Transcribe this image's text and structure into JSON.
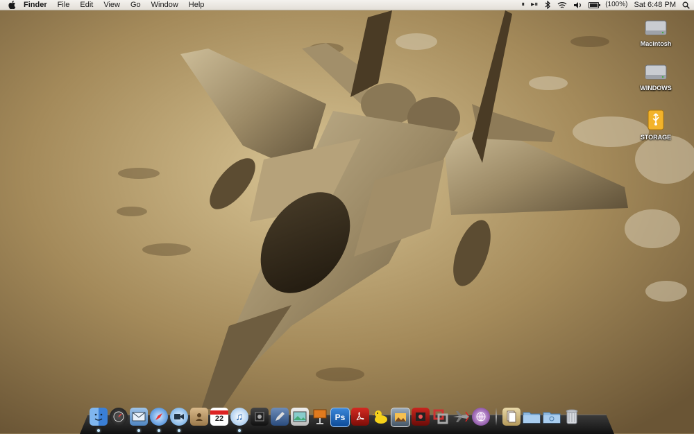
{
  "menubar": {
    "app_name": "Finder",
    "menus": [
      "File",
      "Edit",
      "View",
      "Go",
      "Window",
      "Help"
    ],
    "battery_text": "(100%)",
    "battery_level": 1.0,
    "clock": "Sat 6:48 PM",
    "status_icons": [
      "pause-icon",
      "play-pause-icon",
      "bluetooth-icon",
      "wifi-icon",
      "volume-icon",
      "battery-icon",
      "spotlight-icon"
    ]
  },
  "desktop_icons": [
    {
      "label": "Macintosh",
      "icon": "hard-drive-icon"
    },
    {
      "label": "WINDOWS",
      "icon": "hard-drive-icon"
    },
    {
      "label": "STORAGE",
      "icon": "usb-drive-icon"
    }
  ],
  "dock": {
    "apps": [
      {
        "name": "finder",
        "icon": "finder-icon",
        "running": true
      },
      {
        "name": "dashboard",
        "icon": "dashboard-icon",
        "running": false
      },
      {
        "name": "mail",
        "icon": "mail-icon",
        "running": true
      },
      {
        "name": "safari",
        "icon": "safari-icon",
        "running": true
      },
      {
        "name": "ichat",
        "icon": "ichat-icon",
        "running": true
      },
      {
        "name": "address-book",
        "icon": "address-book-icon",
        "running": false
      },
      {
        "name": "ical",
        "icon": "ical-icon",
        "running": false,
        "badge": "22"
      },
      {
        "name": "itunes",
        "icon": "itunes-icon",
        "running": true
      },
      {
        "name": "dvd-player",
        "icon": "dvd-icon",
        "running": false
      },
      {
        "name": "script-editor",
        "icon": "pen-icon",
        "running": false
      },
      {
        "name": "iphoto",
        "icon": "photo-icon",
        "running": false
      },
      {
        "name": "keynote",
        "icon": "presentation-icon",
        "running": false
      },
      {
        "name": "photoshop",
        "icon": "photoshop-icon",
        "running": false,
        "badge": "Ps"
      },
      {
        "name": "acrobat",
        "icon": "acrobat-icon",
        "running": false
      },
      {
        "name": "cyberduck",
        "icon": "duck-icon",
        "running": false
      },
      {
        "name": "preview",
        "icon": "preview-icon",
        "running": false
      },
      {
        "name": "photo-booth",
        "icon": "photo-booth-icon",
        "running": false
      },
      {
        "name": "parallels",
        "icon": "parallels-icon",
        "running": false
      },
      {
        "name": "x-plane",
        "icon": "airplane-icon",
        "running": false
      },
      {
        "name": "eclipse",
        "icon": "globe-icon",
        "running": false
      }
    ],
    "stack": [
      {
        "name": "documents-stack",
        "icon": "documents-stack-icon"
      },
      {
        "name": "applications-folder",
        "icon": "folder-icon"
      },
      {
        "name": "downloads-folder",
        "icon": "folder-icon"
      },
      {
        "name": "trash",
        "icon": "trash-icon"
      }
    ]
  }
}
